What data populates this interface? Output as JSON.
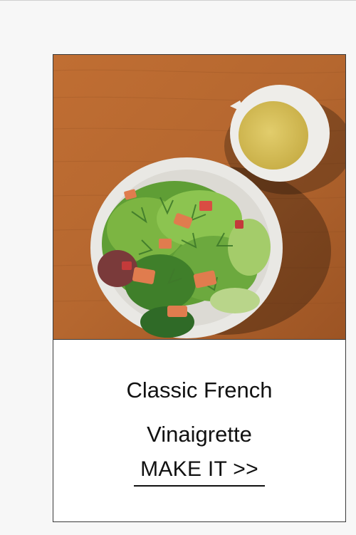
{
  "card": {
    "image": {
      "alt": "Salad with smoked salmon, herbs and a bowl of vinaigrette",
      "colors": {
        "wood": "#b5672f",
        "wood_dark": "#8d4c1f",
        "plate": "#e9e8e4",
        "lettuce": "#6da63c",
        "salmon": "#e07c4e",
        "dressing": "#d9c25a"
      }
    },
    "title_line1": "Classic French",
    "title_line2": "Vinaigrette",
    "cta_label": "MAKE IT >>"
  }
}
